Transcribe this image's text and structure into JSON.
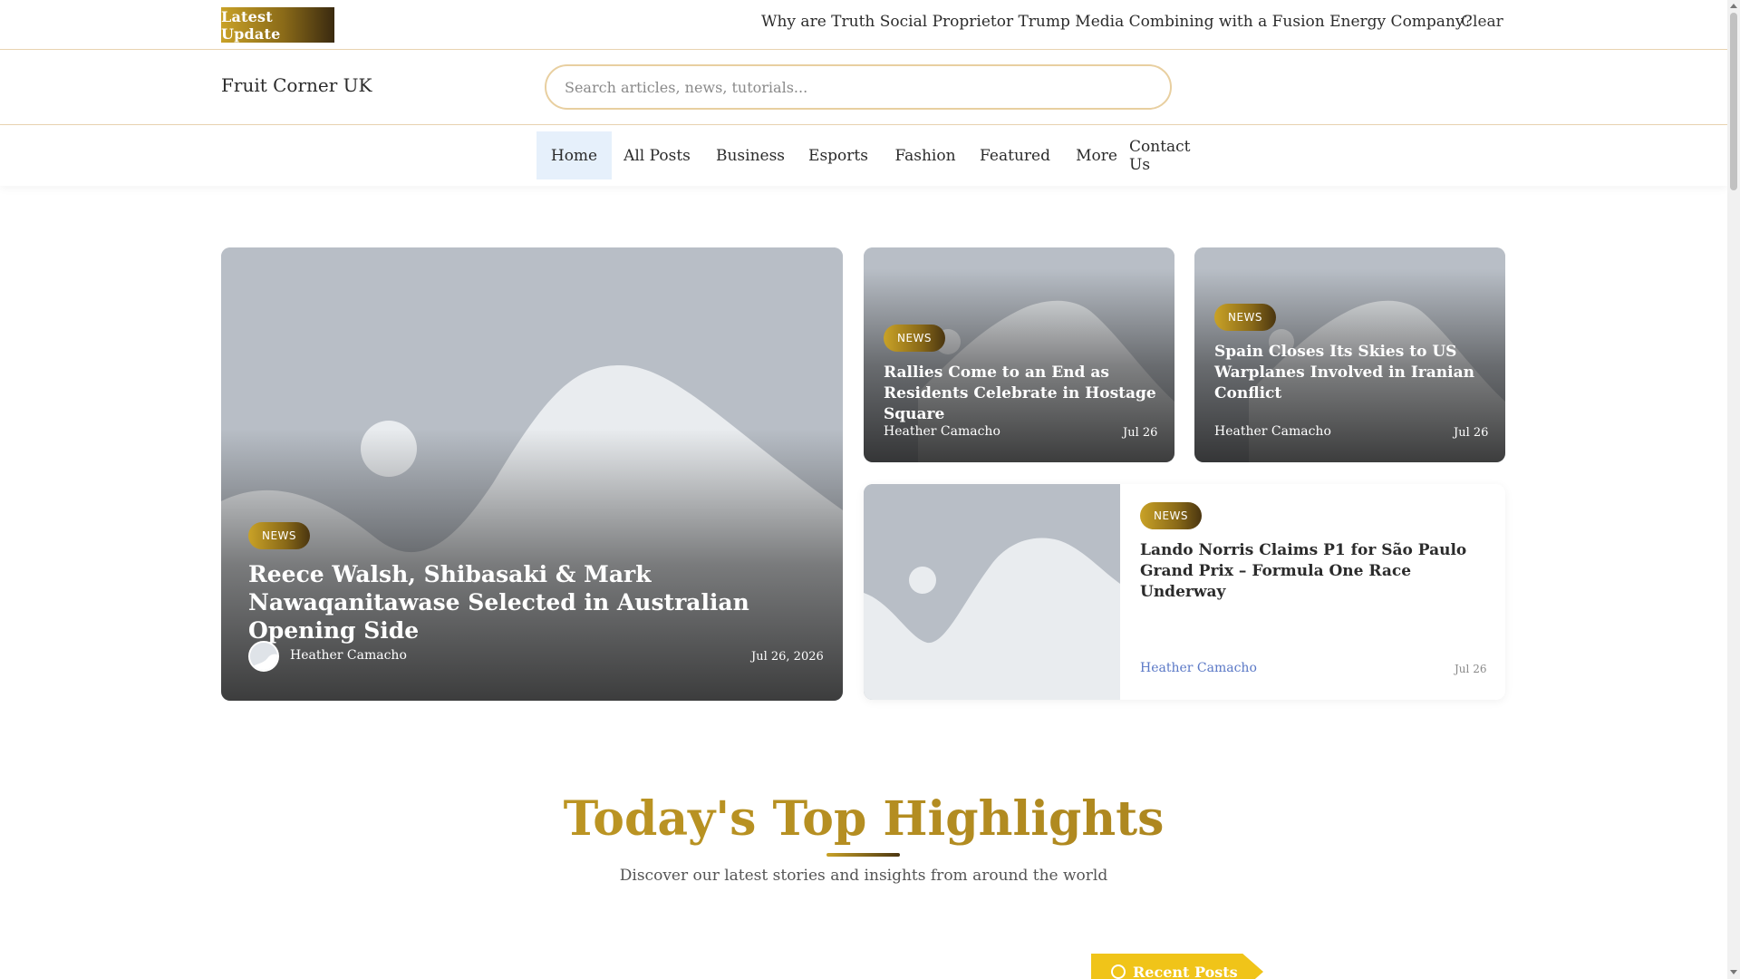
{
  "ticker": {
    "badge": "Latest  Update",
    "headline": "Why are Truth Social Proprietor Trump Media Combining with a Fusion Energy Company?",
    "clear_label": "Clear"
  },
  "header": {
    "site_title": "Fruit Corner UK",
    "search_placeholder": "Search articles, news, tutorials..."
  },
  "nav": {
    "items": [
      {
        "label": "Home",
        "active": true
      },
      {
        "label": "All Posts"
      },
      {
        "label": "Business"
      },
      {
        "label": "Esports"
      },
      {
        "label": "Fashion"
      },
      {
        "label": "Featured"
      },
      {
        "label": "More"
      },
      {
        "label": "Contact Us"
      }
    ]
  },
  "hero": {
    "main": {
      "badge": "NEWS",
      "title": "Reece Walsh, Shibasaki & Mark Nawaqanitawase Selected in Australian Opening Side",
      "author": "Heather Camacho",
      "date": "Jul 26, 2026"
    },
    "small1": {
      "badge": "NEWS",
      "title": "Rallies Come to an End as Residents Celebrate in Hostage Square",
      "author": "Heather Camacho",
      "date": "Jul 26"
    },
    "small2": {
      "badge": "NEWS",
      "title": "Spain Closes Its Skies to US Warplanes Involved in Iranian Conflict",
      "author": "Heather Camacho",
      "date": "Jul 26"
    },
    "wide": {
      "badge": "NEWS",
      "title": "Lando Norris Claims P1 for São Paulo Grand Prix – Formula One Race Underway",
      "author": "Heather Camacho",
      "date": "Jul 26"
    }
  },
  "section": {
    "title": "Today's Top Highlights",
    "subtitle": "Discover our latest stories and insights from around the world",
    "recent_tab": "Recent Posts"
  },
  "colors": {
    "accent_gold": "#c9a227",
    "link_blue": "#5a78c6",
    "nav_active_bg": "#e6f0fb"
  }
}
